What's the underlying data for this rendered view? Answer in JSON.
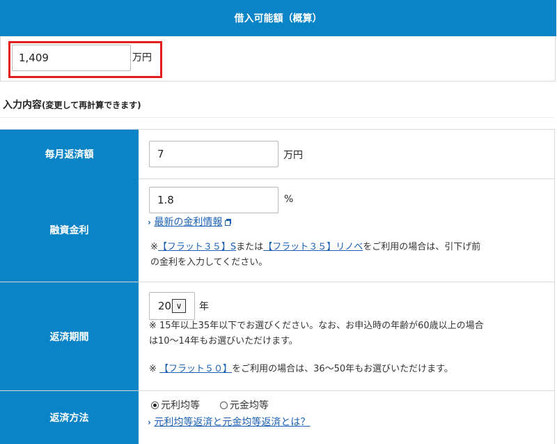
{
  "header": {
    "title": "借入可能額（概算）"
  },
  "result": {
    "value": "1,409",
    "unit": "万円"
  },
  "section": {
    "title": "入力内容",
    "subtitle": "(変更して再計算できます)"
  },
  "monthly_payment": {
    "label": "毎月返済額",
    "value": "7",
    "unit": "万円"
  },
  "interest_rate": {
    "label": "融資金利",
    "value": "1.8",
    "unit": "%",
    "rate_link": "最新の金利情報",
    "note_prefix": "※",
    "note_link1": "【フラット３５】S",
    "note_middle": "または",
    "note_link2": "【フラット３５】リノベ",
    "note_suffix": "をご利用の場合は、引下げ前",
    "note_line2": "の金利を入力してください。"
  },
  "repayment_period": {
    "label": "返済期間",
    "selected": "20",
    "arrow": "∨",
    "unit": "年",
    "note1_line1": "※ 15年以上35年以下でお選びください。なお、お申込時の年齢が60歳以上の場合",
    "note1_line2": "は10～14年もお選びいただけます。",
    "note2_prefix": "※",
    "note2_link": "【フラット５０】",
    "note2_suffix": "をご利用の場合は、36～50年もお選びいただけます。"
  },
  "repayment_method": {
    "label": "返済方法",
    "options": [
      "元利均等",
      "元金均等"
    ],
    "selected_index": 0,
    "help_link": "元利均等返済と元金均等返済とは？"
  },
  "icons": {
    "chevron": "›",
    "external": "external-link-icon"
  },
  "colors": {
    "header_bg": "#0a84c6",
    "highlight": "#e11d1d",
    "link": "#1a5fb4"
  }
}
